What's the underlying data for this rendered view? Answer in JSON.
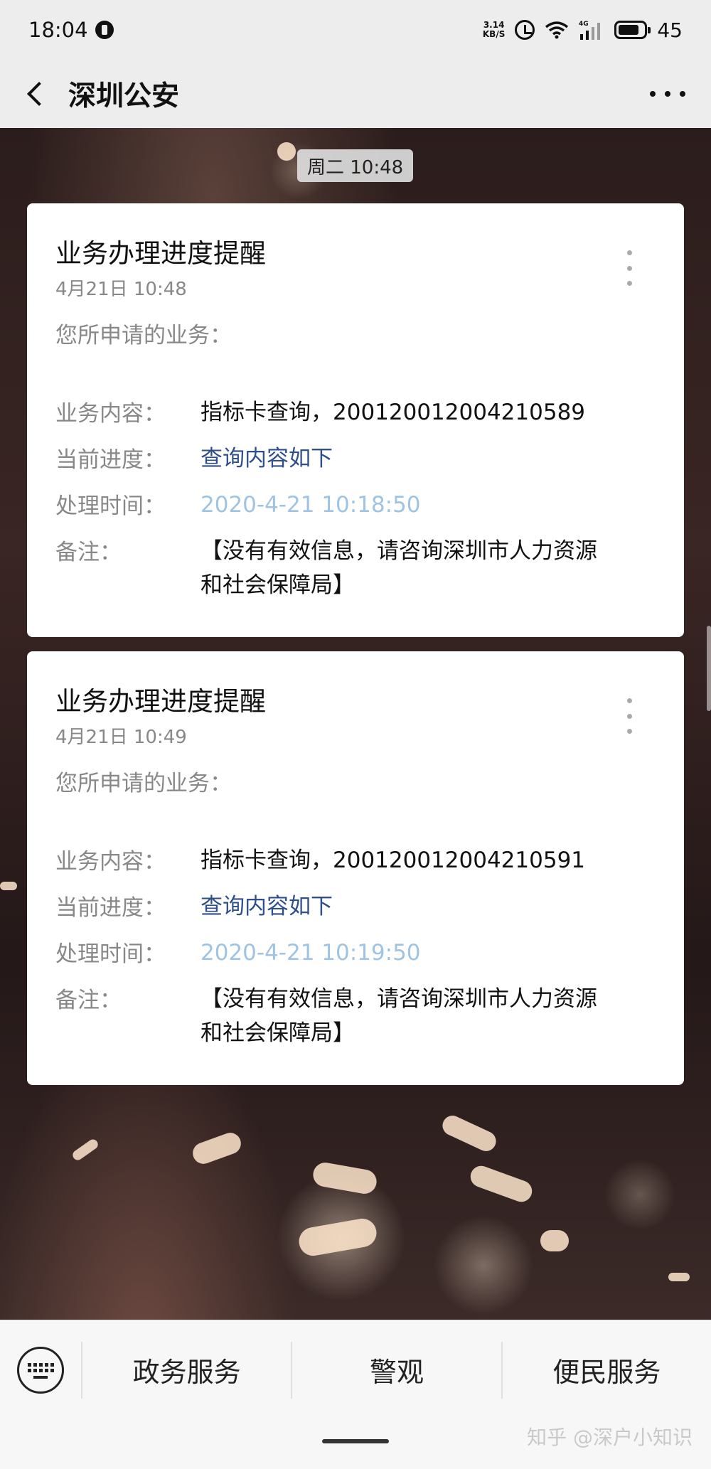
{
  "status_bar": {
    "time": "18:04",
    "net_speed_value": "3.14",
    "net_speed_unit": "KB/S",
    "network_type": "4G",
    "battery": "45"
  },
  "header": {
    "title": "深圳公安"
  },
  "chat": {
    "timestamp": "周二 10:48",
    "cards": [
      {
        "title": "业务办理进度提醒",
        "date": "4月21日  10:48",
        "intro": "您所申请的业务：",
        "rows": [
          {
            "label": "业务内容：",
            "value": "指标卡查询，2001200120042105​89"
          },
          {
            "label": "当前进度：",
            "value": "查询内容如下"
          },
          {
            "label": "处理时间：",
            "value": "2020-4-21 10:18:50"
          },
          {
            "label": "备注：",
            "value_line1": "【没有有效信息，请咨询深圳市人力资源",
            "value_line2": "和社会保障局】"
          }
        ]
      },
      {
        "title": "业务办理进度提醒",
        "date": "4月21日  10:49",
        "intro": "您所申请的业务：",
        "rows": [
          {
            "label": "业务内容：",
            "value": "指标卡查询，200120012004210591"
          },
          {
            "label": "当前进度：",
            "value": "查询内容如下"
          },
          {
            "label": "处理时间：",
            "value": "2020-4-21 10:19:50"
          },
          {
            "label": "备注：",
            "value_line1": "【没有有效信息，请咨询深圳市人力资源",
            "value_line2": "和社会保障局】"
          }
        ]
      }
    ]
  },
  "bottom_menu": {
    "items": [
      "政务服务",
      "警观",
      "便民服务"
    ]
  },
  "watermark": "知乎 @深户小知识",
  "colors": {
    "progress_link": "#2e4f8b",
    "time_value": "#9ec3e3"
  }
}
